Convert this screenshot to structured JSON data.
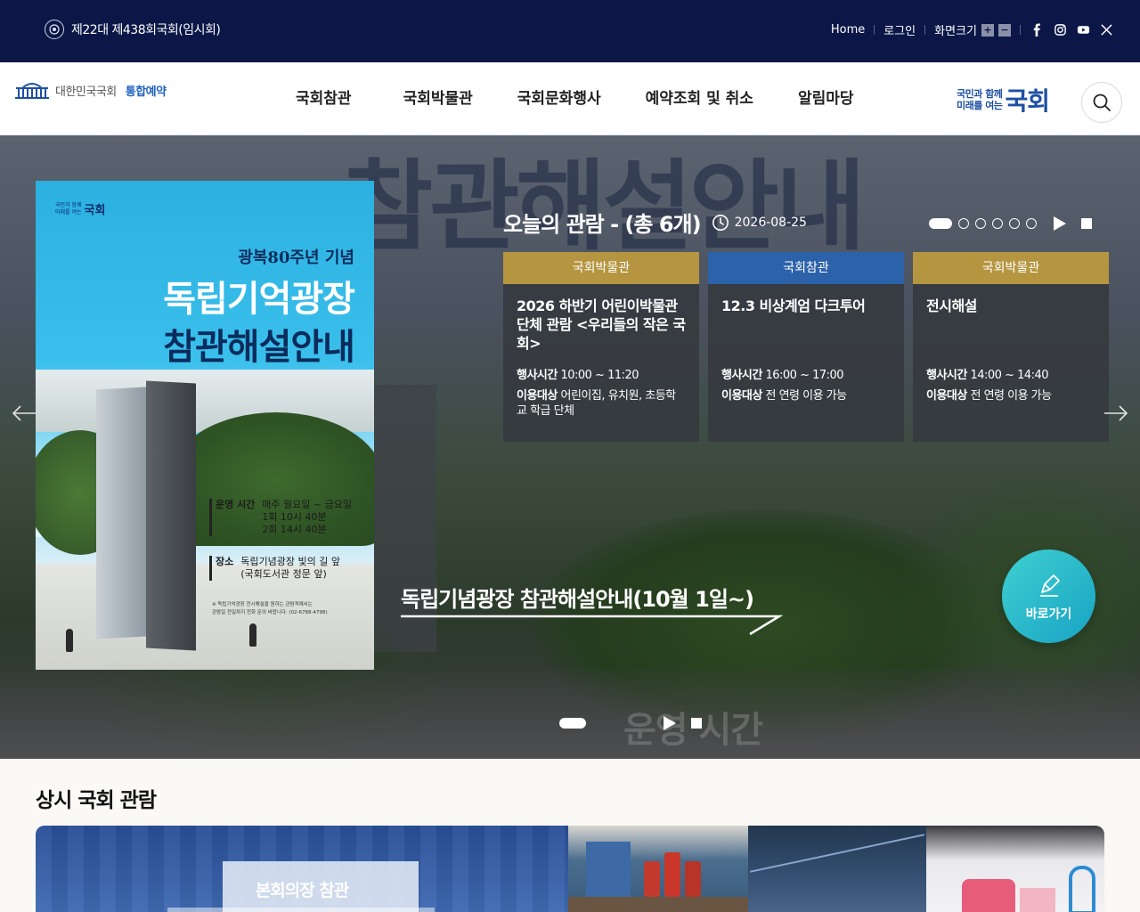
{
  "topbar": {
    "session": "제22대 제438회국회(임시회)",
    "links": {
      "home": "Home",
      "login": "로그인",
      "font_size": "화면크기"
    },
    "font_plus": "+",
    "font_minus": "−",
    "social_icons": [
      "facebook-icon",
      "instagram-icon",
      "youtube-icon",
      "x-icon"
    ]
  },
  "header": {
    "logo_name": "대한민국국회",
    "logo_service": "통합예약",
    "nav": [
      "국회참관",
      "국회박물관",
      "국회문화행사",
      "예약조회 및 취소",
      "알림마당"
    ],
    "slogan_small_1": "국민과 함께",
    "slogan_small_2": "미래를 여는",
    "slogan_big": "국회"
  },
  "hero": {
    "background_text": "참관해설안내",
    "today_title": "오늘의 관람 - (총 6개)",
    "date": "2026-08-25",
    "card_pager_count": 6,
    "card_pager_active": 0,
    "cards": [
      {
        "category": "국회박물관",
        "category_color": "#b59540",
        "title": "2026 하반기 어린이박물관 단체 관람 <우리들의 작은 국회>",
        "time_label": "행사시간",
        "time": "10:00 ~ 11:20",
        "target_label": "이용대상",
        "target": "어린이집, 유치원, 초등학교 학급 단체"
      },
      {
        "category": "국회참관",
        "category_color": "#2c62aa",
        "title": "12.3 비상계엄 다크투어",
        "time_label": "행사시간",
        "time": "16:00 ~ 17:00",
        "target_label": "이용대상",
        "target": "전 연령 이용 가능"
      },
      {
        "category": "국회박물관",
        "category_color": "#b59540",
        "title": "전시해설",
        "time_label": "행사시간",
        "time": "14:00 ~ 14:40",
        "target_label": "이용대상",
        "target": "전 연령 이용 가능"
      }
    ],
    "caption": "독립기념광장 참관해설안내(10월 1일~)",
    "quick_label": "바로가기",
    "banner_pager_count": 1,
    "poster": {
      "logo_small_1": "국민과 함께",
      "logo_small_2": "미래를 여는",
      "logo_big": "국회",
      "anniversary": "광복80주년 기념",
      "title_1": "독립기억광장",
      "title_2": "참관해설안내",
      "hours_label": "운영 시간",
      "hours_days": "매주 월요일 ~ 금요일",
      "hours_1": "1회  10시 40분",
      "hours_2": "2회  14시 40분",
      "place_label": "장소",
      "place_1": "독립기념광장 빛의 길 앞",
      "place_2": "(국회도서관 정문 앞)",
      "note_1": "※ 독립기억광장 전시해설을 원하는 관람객께서는",
      "note_2": "관람일 전일까지 전화 문의 바랍니다. (02-6788-4798)"
    }
  },
  "section": {
    "title": "상시 국회 관람",
    "tile_1": "본회의장 참관"
  }
}
